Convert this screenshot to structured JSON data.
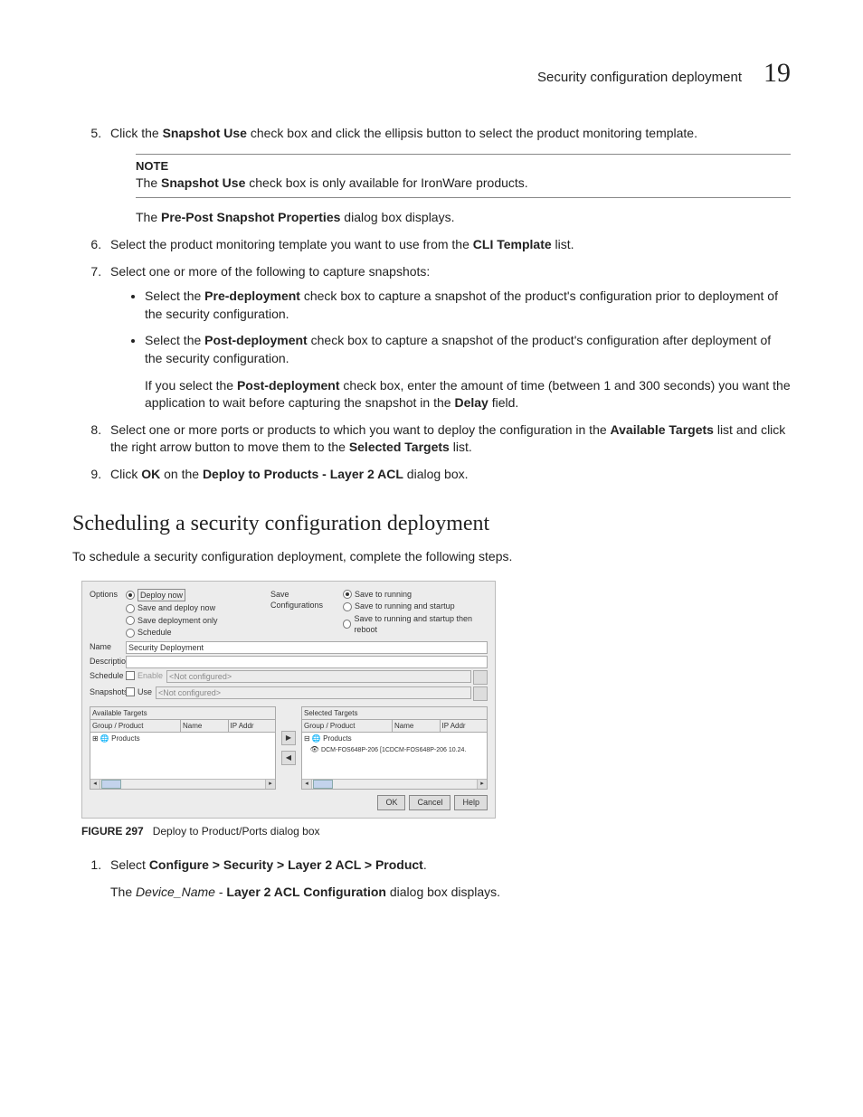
{
  "header": {
    "title": "Security configuration deployment",
    "page": "19"
  },
  "steps_a": {
    "s5_a": "Click the ",
    "s5_b": "Snapshot Use",
    "s5_c": " check box and click the ellipsis button to select the product monitoring template.",
    "note_label": "NOTE",
    "note_a": "The ",
    "note_b": "Snapshot Use",
    "note_c": " check box is only available for IronWare products.",
    "s5_para_a": "The ",
    "s5_para_b": "Pre-Post Snapshot Properties",
    "s5_para_c": " dialog box displays.",
    "s6_a": "Select the product monitoring template you want to use from the ",
    "s6_b": "CLI Template",
    "s6_c": " list.",
    "s7": "Select one or more of the following to capture snapshots:",
    "s7_b1_a": "Select the ",
    "s7_b1_b": "Pre-deployment",
    "s7_b1_c": " check box to capture a snapshot of the product's configuration prior to deployment of the security configuration.",
    "s7_b2_a": "Select the ",
    "s7_b2_b": "Post-deployment",
    "s7_b2_c": " check box to capture a snapshot of the product's configuration after deployment of the security configuration.",
    "s7_p_a": "If you select the ",
    "s7_p_b": "Post-deployment",
    "s7_p_c": " check box, enter the amount of time (between 1 and 300 seconds) you want the application to wait before capturing the snapshot in the ",
    "s7_p_d": "Delay",
    "s7_p_e": " field.",
    "s8_a": "Select one or more ports or products to which you want to deploy the configuration in the ",
    "s8_b": "Available Targets",
    "s8_c": " list and click the right arrow button to move them to the ",
    "s8_d": "Selected Targets",
    "s8_e": " list.",
    "s9_a": "Click ",
    "s9_b": "OK",
    "s9_c": " on the ",
    "s9_d": "Deploy to Products - Layer 2 ACL",
    "s9_e": " dialog box."
  },
  "section_heading": "Scheduling a security configuration deployment",
  "section_intro": "To schedule a security configuration deployment, complete the following steps.",
  "dialog": {
    "options_label": "Options",
    "opt1": "Deploy now",
    "opt2": "Save and deploy now",
    "opt3": "Save deployment only",
    "opt4": "Schedule",
    "save_label": "Save Configurations",
    "sc1": "Save to running",
    "sc2": "Save to running and startup",
    "sc3": "Save to running and startup then reboot",
    "name_label": "Name",
    "name_value": "Security Deployment",
    "desc_label": "Description",
    "desc_value": "",
    "sched_label": "Schedule",
    "sched_chk": "Enable",
    "sched_value": "<Not configured>",
    "snap_label": "Snapshots",
    "snap_chk": "Use",
    "snap_value": "<Not configured>",
    "avail_hdr": "Available Targets",
    "sel_hdr": "Selected Targets",
    "col_gp": "Group / Product",
    "col_name": "Name",
    "col_ip": "IP Addr",
    "tree_products": "Products",
    "sel_row": "DCM-FOS648P-206 [1CDCM-FOS648P-206  10.24.",
    "btn_ok": "OK",
    "btn_cancel": "Cancel",
    "btn_help": "Help"
  },
  "figure": {
    "label": "FIGURE 297",
    "caption": "Deploy to Product/Ports dialog box"
  },
  "steps_b": {
    "s1_a": "Select ",
    "s1_b": "Configure > Security > Layer 2 ACL > Product",
    "s1_c": ".",
    "s1_p_a": "The ",
    "s1_p_b": "Device_Name",
    "s1_p_c": " - ",
    "s1_p_d": "Layer 2 ACL Configuration",
    "s1_p_e": " dialog box displays."
  }
}
